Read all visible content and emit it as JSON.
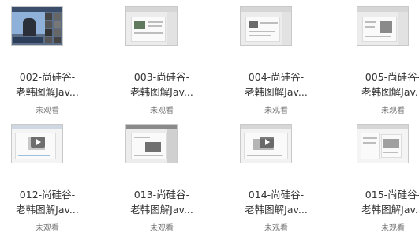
{
  "status_color": "#777777",
  "videos": [
    {
      "title_line1": "002-尚硅谷-",
      "title_line2": "老韩图解Jav...",
      "status": "未观看"
    },
    {
      "title_line1": "003-尚硅谷-",
      "title_line2": "老韩图解Jav...",
      "status": "未观看"
    },
    {
      "title_line1": "004-尚硅谷-",
      "title_line2": "老韩图解Jav...",
      "status": "未观看"
    },
    {
      "title_line1": "005-尚硅谷-",
      "title_line2": "老韩图解Jav...",
      "status": "未观看"
    },
    {
      "title_line1": "012-尚硅谷-",
      "title_line2": "老韩图解Jav...",
      "status": "未观看"
    },
    {
      "title_line1": "013-尚硅谷-",
      "title_line2": "老韩图解Jav...",
      "status": "未观看"
    },
    {
      "title_line1": "014-尚硅谷-",
      "title_line2": "老韩图解Jav...",
      "status": "未观看"
    },
    {
      "title_line1": "015-尚硅谷-",
      "title_line2": "老韩图解Jav...",
      "status": "未观看"
    }
  ]
}
